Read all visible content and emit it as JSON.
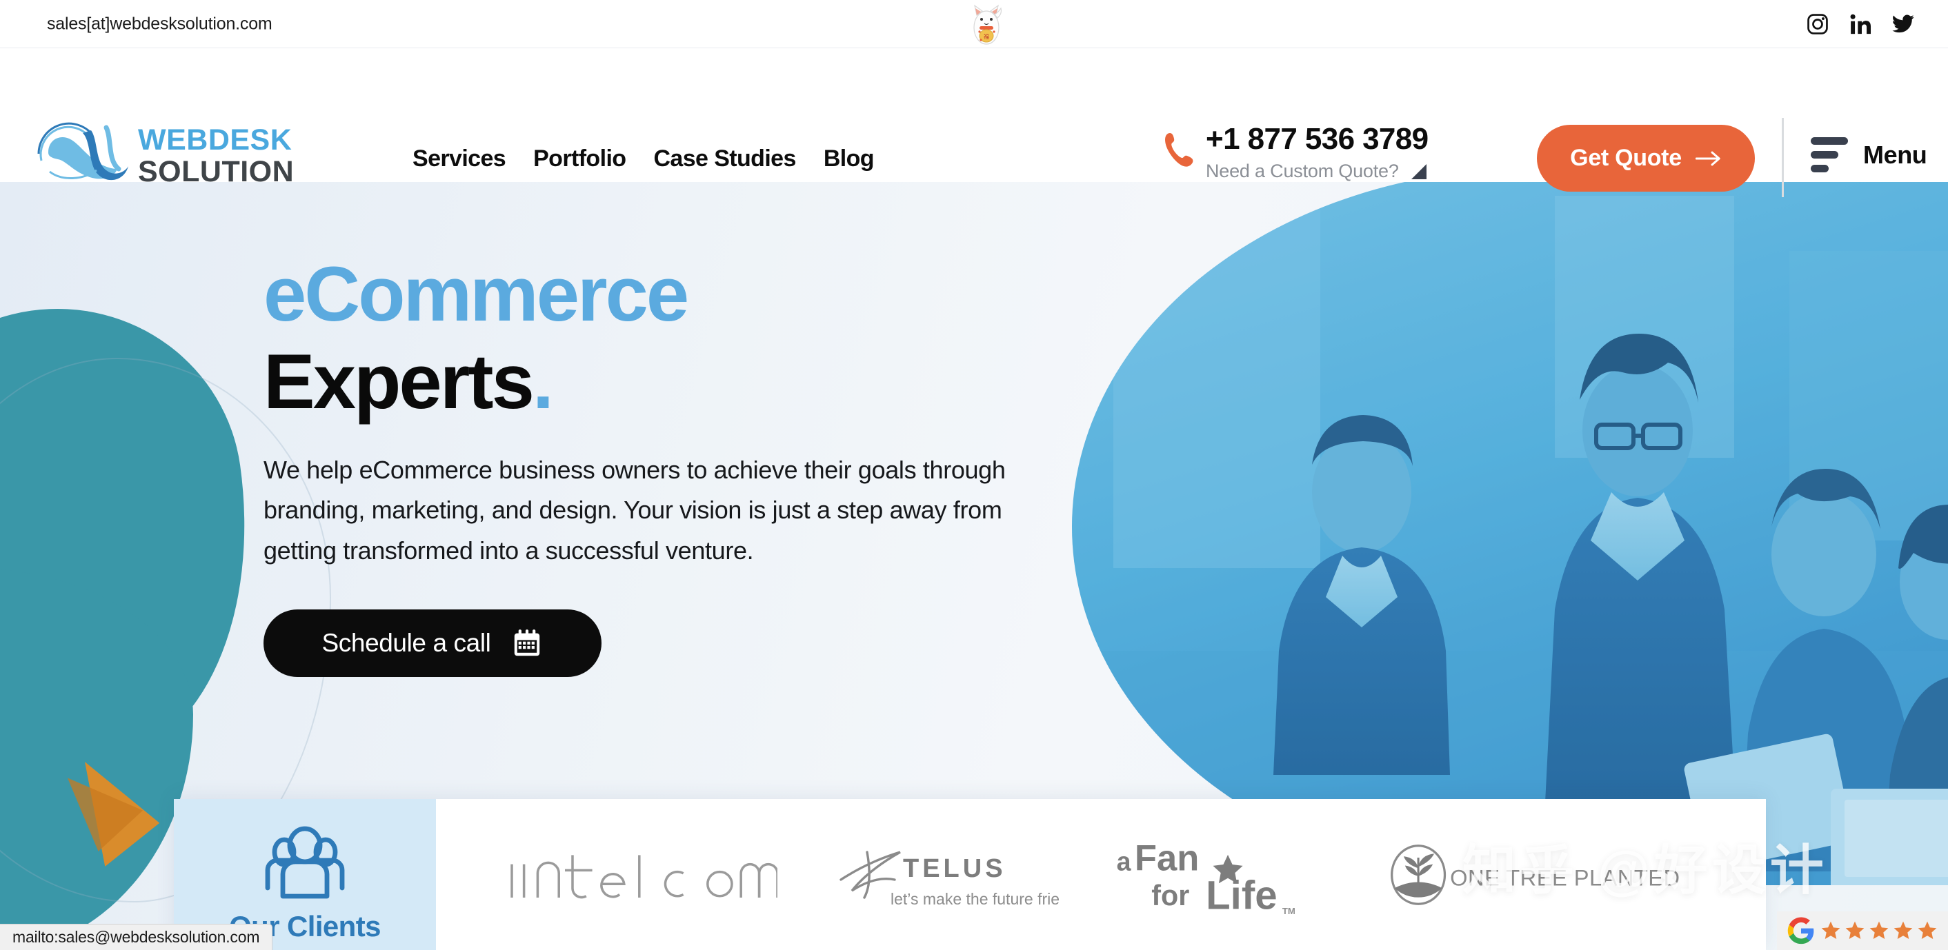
{
  "topbar": {
    "email": "sales[at]webdesksolution.com",
    "social": [
      {
        "name": "instagram-icon",
        "label": "Instagram"
      },
      {
        "name": "linkedin-icon",
        "label": "LinkedIn"
      },
      {
        "name": "twitter-icon",
        "label": "Twitter"
      }
    ],
    "center_image_alt": "lucky-cat"
  },
  "header": {
    "logo": {
      "line1": "WEBDESK",
      "line2": "SOLUTION"
    },
    "nav": [
      {
        "label": "Services"
      },
      {
        "label": "Portfolio"
      },
      {
        "label": "Case Studies"
      },
      {
        "label": "Blog"
      }
    ],
    "phone": "+1 877 536 3789",
    "quote_prompt": "Need a Custom Quote?",
    "cta_label": "Get Quote",
    "menu_label": "Menu"
  },
  "hero": {
    "title_blue": "eCommerce",
    "title_dark": "Experts",
    "title_dot": ".",
    "paragraph": "We help eCommerce business owners to achieve their goals through branding, marketing, and design. Your vision is just a step away from getting transformed into a successful venture.",
    "cta_label": "Schedule a call"
  },
  "clients": {
    "title": "Our Clients",
    "logos": [
      {
        "name": "intelcom",
        "text": "intelcom"
      },
      {
        "name": "telus",
        "text": "TELUS",
        "tagline": "let's make the future friendly"
      },
      {
        "name": "a-fan-for-life",
        "line1": "a Fan",
        "line2": "for Life",
        "tm": "TM"
      },
      {
        "name": "one-tree-planted",
        "text": "ONE TREE PLANTED"
      }
    ]
  },
  "watermark": {
    "text": "知乎 @好设计"
  },
  "google_badge": {
    "stars": 5,
    "star_color": "#E8803A"
  },
  "statusbar": {
    "url": "mailto:sales@webdesksolution.com"
  },
  "colors": {
    "accent_orange": "#E8653A",
    "brand_blue": "#5BAADF",
    "logo_blue": "#4AA8DE",
    "logo_gray": "#3F4448",
    "teal_blob": "#3A97A8",
    "orange_shape": "#D98C2C",
    "clients_bg": "#D4E9F7",
    "clients_title": "#2E7AB8"
  }
}
